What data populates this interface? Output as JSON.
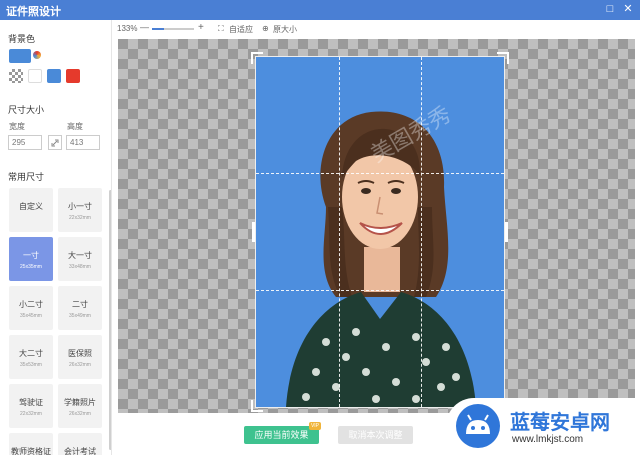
{
  "window": {
    "title": "证件照设计",
    "minimize": "—",
    "maximize": "□",
    "close": "✕"
  },
  "sidebar": {
    "background_label": "背景色",
    "background_colors": {
      "selected": "#4a8ad8",
      "white": "#ffffff",
      "blue": "#4a8ad8",
      "red": "#e53a2c"
    },
    "size_label": "尺寸大小",
    "width_label": "宽度",
    "height_label": "高度",
    "width_value": "295",
    "height_value": "413",
    "link_icon": "link-icon",
    "common_label": "常用尺寸",
    "sizes": [
      {
        "name": "自定义",
        "dim": ""
      },
      {
        "name": "小一寸",
        "dim": "22x32mm"
      },
      {
        "name": "一寸",
        "dim": "25x35mm"
      },
      {
        "name": "大一寸",
        "dim": "33x48mm"
      },
      {
        "name": "小二寸",
        "dim": "35x45mm"
      },
      {
        "name": "二寸",
        "dim": "35x49mm"
      },
      {
        "name": "大二寸",
        "dim": "35x53mm"
      },
      {
        "name": "医保照",
        "dim": "26x32mm"
      },
      {
        "name": "驾驶证",
        "dim": "22x32mm"
      },
      {
        "name": "学籍照片",
        "dim": "26x32mm"
      },
      {
        "name": "教师资格证",
        "dim": ""
      },
      {
        "name": "会计考试",
        "dim": ""
      }
    ],
    "selected_size": "一寸"
  },
  "toolbar": {
    "zoom": "133%",
    "zoom_out": "—",
    "zoom_in": "+",
    "fit_label": "自适应",
    "original_label": "原大小"
  },
  "canvas": {
    "photo_background": "#4d8ede",
    "watermark": "美图秀秀"
  },
  "bottom": {
    "apply_label": "应用当前效果",
    "vip_badge": "VIP",
    "cancel_label": "取消本次调整"
  },
  "overlay": {
    "brand": "蓝莓安卓网",
    "url": "www.lmkjst.com"
  }
}
